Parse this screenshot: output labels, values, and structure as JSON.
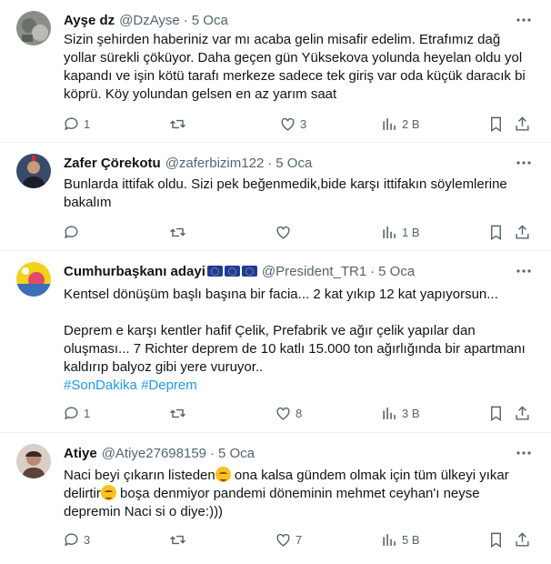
{
  "tweets": [
    {
      "name": "Ayşe dz",
      "handle": "@DzAyse",
      "time": "5 Oca",
      "text": "Sizin şehirden haberiniz var mı acaba gelin misafir edelim. Etrafımız dağ yollar sürekli çöküyor. Daha geçen gün Yüksekova yolunda heyelan oldu yol kapandı ve işin kötü tarafı merkeze sadece tek giriş var oda küçük daracık bi köprü. Köy yolundan gelsen en az yarım saat",
      "replies": "1",
      "retweets": "",
      "likes": "3",
      "views": "2 B"
    },
    {
      "name": "Zafer Çörekotu",
      "handle": "@zaferbizim122",
      "time": "5 Oca",
      "text": "Bunlarda ittifak oldu. Sizi pek beğenmedik,bide karşı ittifakın söylemlerine bakalım",
      "replies": "",
      "retweets": "",
      "likes": "",
      "views": "1 B"
    },
    {
      "name": "Cumhurbaşkanı adayi",
      "handle": "@President_TR1",
      "time": "5 Oca",
      "text_line1": "Kentsel dönüşüm başlı başına bir facia... 2 kat yıkıp 12 kat yapıyorsun...",
      "text_line2": "Deprem e karşı kentler hafif Çelik, Prefabrik ve ağır çelik yapılar dan oluşması... 7 Richter deprem de 10 katlı 15.000 ton ağırlığında bir apartmanı kaldırıp balyoz gibi yere vuruyor..",
      "hashtag1": "#SonDakika",
      "hashtag2": "#Deprem",
      "replies": "1",
      "retweets": "",
      "likes": "8",
      "views": "3 B"
    },
    {
      "name": "Atiye",
      "handle": "@Atiye27698159",
      "time": "5 Oca",
      "text_a": "Naci beyi çıkarın listeden",
      "text_b": " ona kalsa gündem olmak için tüm ülkeyi yıkar delirtir",
      "text_c": " boşa denmiyor pandemi döneminin mehmet ceyhan'ı neyse depremin Naci si o diye:)))",
      "replies": "3",
      "retweets": "",
      "likes": "7",
      "views": "5 B"
    }
  ],
  "icons": {
    "reply": "reply-icon",
    "retweet": "retweet-icon",
    "like": "heart-icon",
    "views": "views-icon",
    "bookmark": "bookmark-icon",
    "share": "share-icon",
    "more": "more-icon"
  },
  "colors": {
    "accent": "#1d9bf0",
    "muted": "#536471",
    "text": "#0f1419",
    "divider": "#eff3f4"
  }
}
